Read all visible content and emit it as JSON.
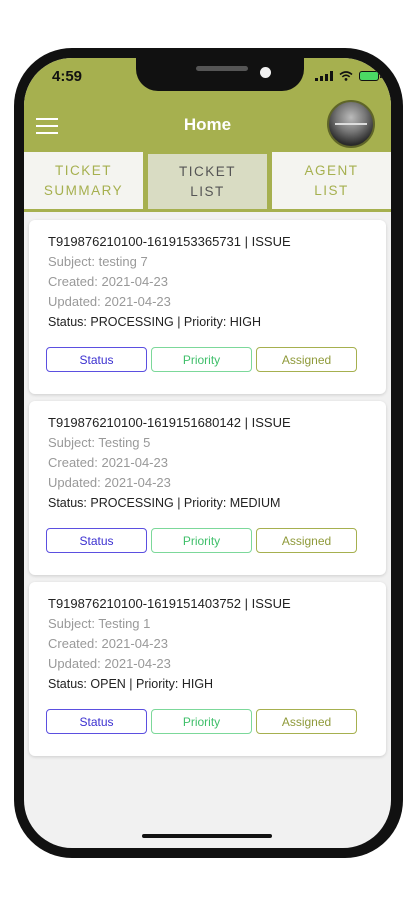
{
  "status_bar": {
    "time": "4:59"
  },
  "app_bar": {
    "title": "Home"
  },
  "tabs": [
    {
      "line1": "TICKET",
      "line2": "SUMMARY",
      "active": false
    },
    {
      "line1": "TICKET",
      "line2": "LIST",
      "active": true
    },
    {
      "line1": "AGENT",
      "line2": "LIST",
      "active": false
    }
  ],
  "tickets": [
    {
      "id": "T919876210100-1619153365731  |  ISSUE",
      "subject": "Subject: testing 7",
      "created": "Created: 2021-04-23",
      "updated": "Updated: 2021-04-23",
      "status_line": "Status: PROCESSING | Priority: HIGH"
    },
    {
      "id": "T919876210100-1619151680142  |  ISSUE",
      "subject": "Subject: Testing 5",
      "created": "Created: 2021-04-23",
      "updated": "Updated: 2021-04-23",
      "status_line": "Status: PROCESSING | Priority: MEDIUM"
    },
    {
      "id": "T919876210100-1619151403752  |  ISSUE",
      "subject": "Subject: Testing 1",
      "created": "Created: 2021-04-23",
      "updated": "Updated: 2021-04-23",
      "status_line": "Status: OPEN | Priority: HIGH"
    }
  ],
  "buttons": {
    "status": "Status",
    "priority": "Priority",
    "assigned": "Assigned"
  },
  "colors": {
    "accent": "#a6b04f",
    "status_btn": "#5b4fe0",
    "priority_btn": "#7cd89a"
  },
  "icons": [
    "menu-icon",
    "avatar",
    "signal-icon",
    "wifi-icon",
    "battery-icon"
  ]
}
